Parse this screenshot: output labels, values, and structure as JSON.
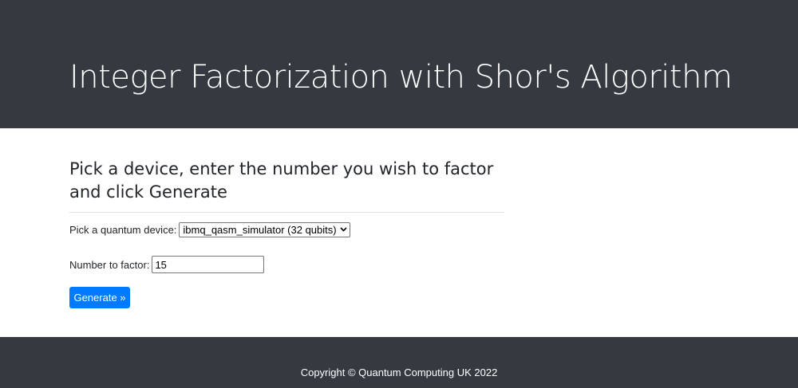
{
  "header": {
    "title": "Integer Factorization with Shor's Algorithm"
  },
  "main": {
    "heading": "Pick a device, enter the number you wish to factor and click Generate",
    "device_label": "Pick a quantum device:",
    "device_selected": "ibmq_qasm_simulator (32 qubits)",
    "factor_label": "Number to factor:",
    "factor_value": "15",
    "generate_label": "Generate »"
  },
  "footer": {
    "text": "Copyright © Quantum Computing UK 2022"
  },
  "colors": {
    "dark": "#343a40",
    "primary": "#007bff"
  },
  "icons": {
    "select_arrow": "chevron-down-icon"
  }
}
